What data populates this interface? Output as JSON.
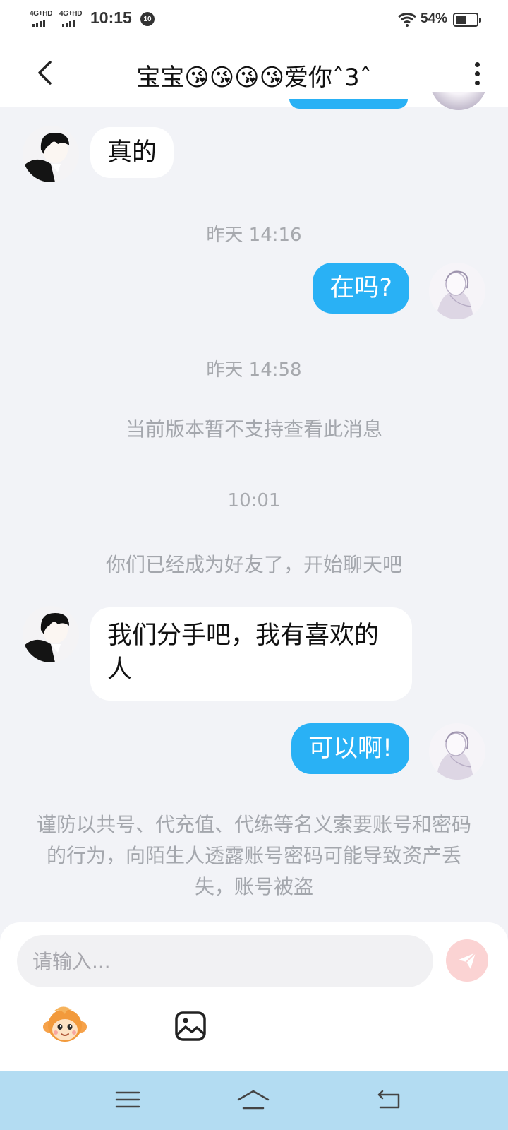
{
  "status_bar": {
    "sim1_label": "4G+HD",
    "sim2_label": "4G+HD",
    "time": "10:15",
    "notification_badge": "10",
    "battery_percent": "54%",
    "battery_level": 0.54
  },
  "header": {
    "title": "宝宝😘😘😘😘爱你ˆ3ˆ",
    "back_icon": "chevron-left-icon",
    "more_icon": "more-vertical-icon"
  },
  "messages": {
    "m1": {
      "side": "left",
      "text": "真的"
    },
    "t1": "昨天 14:16",
    "m2": {
      "side": "right",
      "text": "在吗?"
    },
    "t2": "昨天 14:58",
    "sys1": "当前版本暂不支持查看此消息",
    "t3": "10:01",
    "sys2": "你们已经成为好友了，开始聊天吧",
    "m3": {
      "side": "left",
      "text": "我们分手吧，我有喜欢的人"
    },
    "m4": {
      "side": "right",
      "text": "可以啊!"
    }
  },
  "warning": "谨防以共号、代充值、代练等名义索要账号和密码的行为，向陌生人透露账号密码可能导致资产丢失，账号被盗",
  "composer": {
    "placeholder": "请输入...",
    "send_icon": "paper-plane-icon",
    "emoji_icon": "monkey-emoji-icon",
    "image_icon": "image-icon"
  },
  "nav_bar": {
    "menu_icon": "menu-icon",
    "home_icon": "home-icon",
    "back_icon": "back-icon"
  },
  "colors": {
    "accent_bubble": "#29b1f5",
    "background": "#f2f3f7",
    "nav_bar": "#b3dcf2",
    "send_button": "#fbd3d3"
  }
}
